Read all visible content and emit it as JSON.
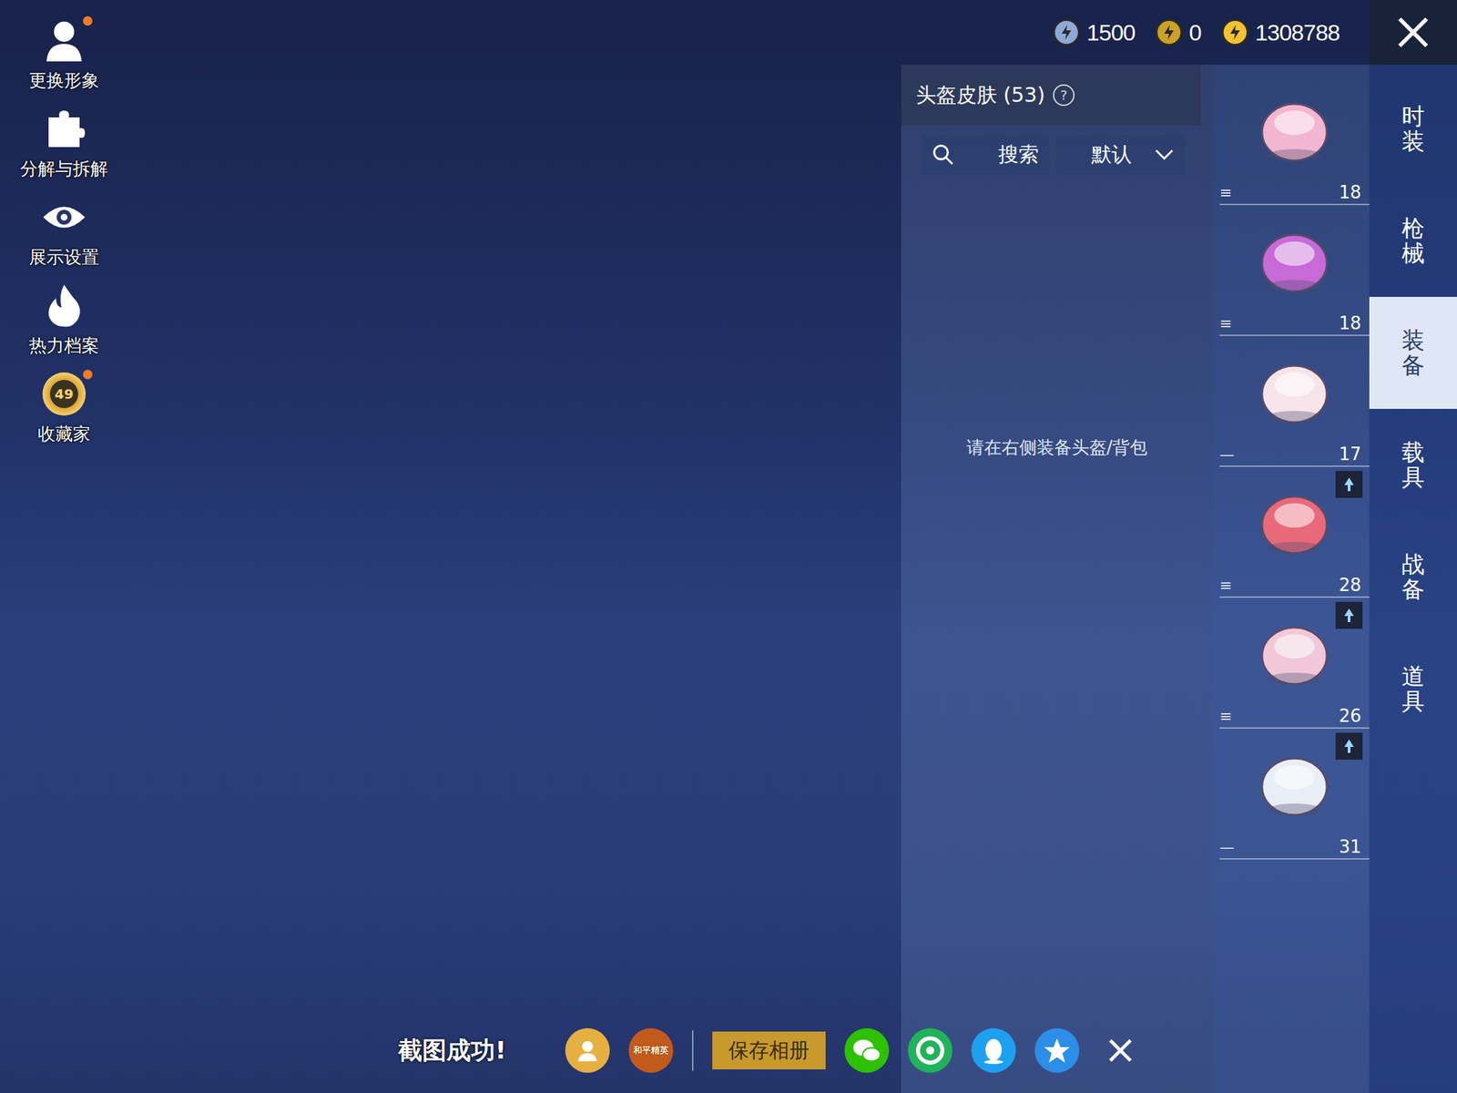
{
  "left_menu": [
    {
      "label": "更换形象",
      "dot": true,
      "badge": ""
    },
    {
      "label": "分解与拆解",
      "dot": false,
      "badge": ""
    },
    {
      "label": "展示设置",
      "dot": false,
      "badge": ""
    },
    {
      "label": "热力档案",
      "dot": false,
      "badge": ""
    },
    {
      "label": "收藏家",
      "dot": true,
      "badge": "49"
    }
  ],
  "currencies": [
    {
      "amount": "1500",
      "color": "#8fa8d8"
    },
    {
      "amount": "0",
      "color": "#c9a227"
    },
    {
      "amount": "1308788",
      "color": "#f2c230"
    }
  ],
  "panel": {
    "title": "头盔皮肤 (53)",
    "help": "?",
    "search": "搜索",
    "sort": "默认",
    "hint": "请在右侧装备头盔/背包"
  },
  "items": [
    {
      "count": "18",
      "handle": "≡",
      "badge": false,
      "color": "#f3b6d0"
    },
    {
      "count": "18",
      "handle": "≡",
      "badge": false,
      "color": "#c86ad8"
    },
    {
      "count": "17",
      "handle": "—",
      "badge": false,
      "color": "#f7e4ea"
    },
    {
      "count": "28",
      "handle": "≡",
      "badge": true,
      "color": "#e86a7a"
    },
    {
      "count": "26",
      "handle": "≡",
      "badge": true,
      "color": "#f0c8d8"
    },
    {
      "count": "31",
      "handle": "—",
      "badge": true,
      "color": "#e8eef6"
    }
  ],
  "tabs": [
    {
      "label": "时装",
      "selected": false
    },
    {
      "label": "枪械",
      "selected": false
    },
    {
      "label": "装备",
      "selected": true
    },
    {
      "label": "载具",
      "selected": false
    },
    {
      "label": "战备",
      "selected": false
    },
    {
      "label": "道具",
      "selected": false
    }
  ],
  "share_bar": {
    "toast": "截图成功!",
    "logo_text": "和平精英",
    "save": "保存相册"
  }
}
